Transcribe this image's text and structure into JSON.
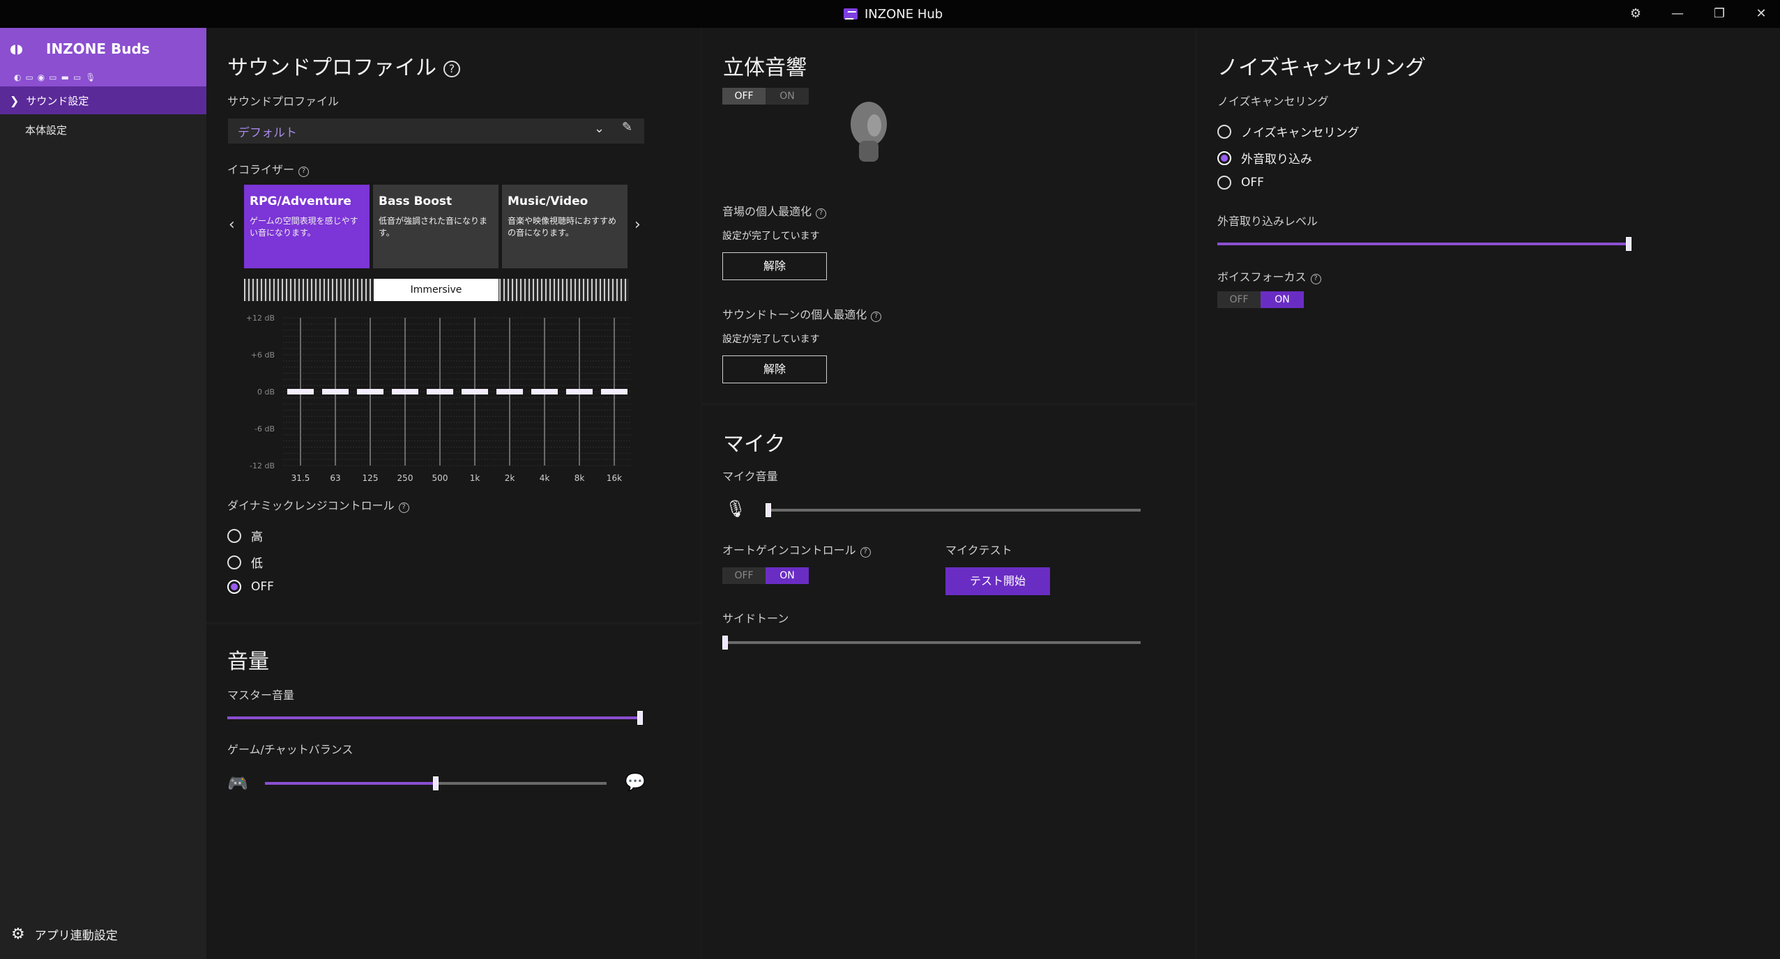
{
  "app": {
    "title": "INZONE Hub"
  },
  "window": {
    "settings_icon": "gear-icon",
    "minimize": "—",
    "restore": "❐",
    "close": "✕"
  },
  "sidebar": {
    "device_name": "INZONE Buds",
    "nav": [
      {
        "label": "サウンド設定",
        "selected": true
      },
      {
        "label": "本体設定",
        "selected": false
      }
    ],
    "app_link": "アプリ連動設定"
  },
  "sound_profile": {
    "title": "サウンドプロファイル",
    "profile_label": "サウンドプロファイル",
    "selected_profile": "デフォルト",
    "equalizer_label": "イコライザー",
    "presets": [
      {
        "title": "RPG/Adventure",
        "desc": "ゲームの空間表現を感じやすい音になります。",
        "selected": true
      },
      {
        "title": "Bass Boost",
        "desc": "低音が強調された音になります。",
        "selected": false
      },
      {
        "title": "Music/Video",
        "desc": "音楽や映像視聴時におすすめの音になります。",
        "selected": false
      }
    ],
    "immersive_label": "Immersive",
    "dynamic_range_label": "ダイナミックレンジコントロール",
    "dynamic_range_options": [
      {
        "label": "高",
        "selected": false
      },
      {
        "label": "低",
        "selected": false
      },
      {
        "label": "OFF",
        "selected": true
      }
    ]
  },
  "chart_data": {
    "type": "bar",
    "categories": [
      "31.5",
      "63",
      "125",
      "250",
      "500",
      "1k",
      "2k",
      "4k",
      "8k",
      "16k"
    ],
    "values": [
      0,
      0,
      0,
      0,
      0,
      0,
      0,
      0,
      0,
      0
    ],
    "ytick_labels": [
      "+12 dB",
      "+6 dB",
      "0 dB",
      "-6 dB",
      "-12 dB"
    ],
    "ylim": [
      -12,
      12
    ]
  },
  "volume": {
    "title": "音量",
    "master_label": "マスター音量",
    "master_value": 1.0,
    "balance_label": "ゲーム/チャットバランス",
    "balance_value": 0.5
  },
  "spatial": {
    "title": "立体音響",
    "toggle_off": "OFF",
    "toggle_on": "ON",
    "state": "OFF",
    "field_opt_label": "音場の個人最適化",
    "field_opt_status": "設定が完了しています",
    "field_opt_button": "解除",
    "tone_opt_label": "サウンドトーンの個人最適化",
    "tone_opt_status": "設定が完了しています",
    "tone_opt_button": "解除"
  },
  "mic": {
    "title": "マイク",
    "volume_label": "マイク音量",
    "volume_value": 0.0,
    "agc_label": "オートゲインコントロール",
    "agc_off": "OFF",
    "agc_on": "ON",
    "agc_state": "ON",
    "test_label": "マイクテスト",
    "test_button": "テスト開始",
    "sidetone_label": "サイドトーン",
    "sidetone_value": 0.0
  },
  "noise_cancel": {
    "title": "ノイズキャンセリング",
    "section_label": "ノイズキャンセリング",
    "options": [
      {
        "label": "ノイズキャンセリング",
        "selected": false
      },
      {
        "label": "外音取り込み",
        "selected": true
      },
      {
        "label": "OFF",
        "selected": false
      }
    ],
    "ambient_level_label": "外音取り込みレベル",
    "ambient_level_value": 1.0,
    "voice_focus_label": "ボイスフォーカス",
    "voice_focus_off": "OFF",
    "voice_focus_on": "ON",
    "voice_focus_state": "ON"
  }
}
